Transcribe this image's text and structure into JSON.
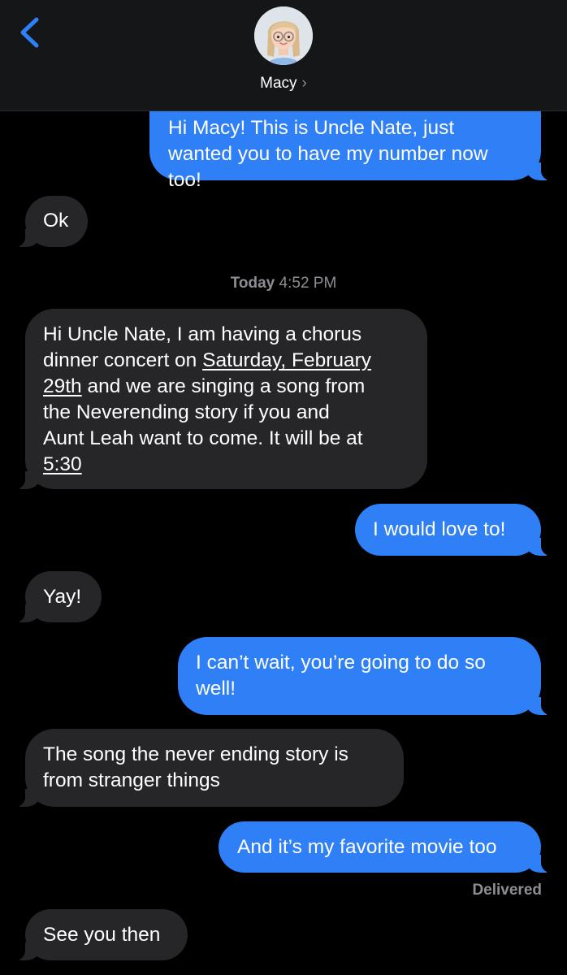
{
  "header": {
    "contact_name": "Macy",
    "chevron": "›",
    "back_icon": "chevron-left-icon",
    "avatar_icon": "memoji-avatar-icon"
  },
  "timestamp": {
    "day": "Today",
    "time": "4:52 PM"
  },
  "messages": [
    {
      "from": "me",
      "text_partial_hidden": "Hi Macy! This is Uncle Nate, just",
      "lines": [
        "wanted you to have my number now",
        "too!"
      ]
    },
    {
      "from": "them",
      "text": "Ok"
    },
    {
      "from": "them",
      "lines": [
        "Hi Uncle Nate, I am having a chorus",
        "dinner concert on ",
        "Saturday, February",
        "29th",
        " and we are singing a song from",
        "the Neverending story if you and",
        "Aunt Leah want to come. It will be at",
        "5:30"
      ]
    },
    {
      "from": "me",
      "text": "I would love to!"
    },
    {
      "from": "them",
      "text": "Yay!"
    },
    {
      "from": "me",
      "lines": [
        "I can’t wait, you’re going to do so",
        "well!"
      ]
    },
    {
      "from": "them",
      "lines": [
        "The song the never ending story is",
        "from stranger things"
      ]
    },
    {
      "from": "me",
      "text": "And it’s my favorite movie too"
    },
    {
      "from": "them",
      "text": "See you then"
    }
  ],
  "status": {
    "delivered": "Delivered"
  },
  "colors": {
    "sent_bubble": "#2f7ff6",
    "received_bubble": "#262629",
    "accent": "#2f7ff6",
    "meta_text": "#8d8d93"
  }
}
